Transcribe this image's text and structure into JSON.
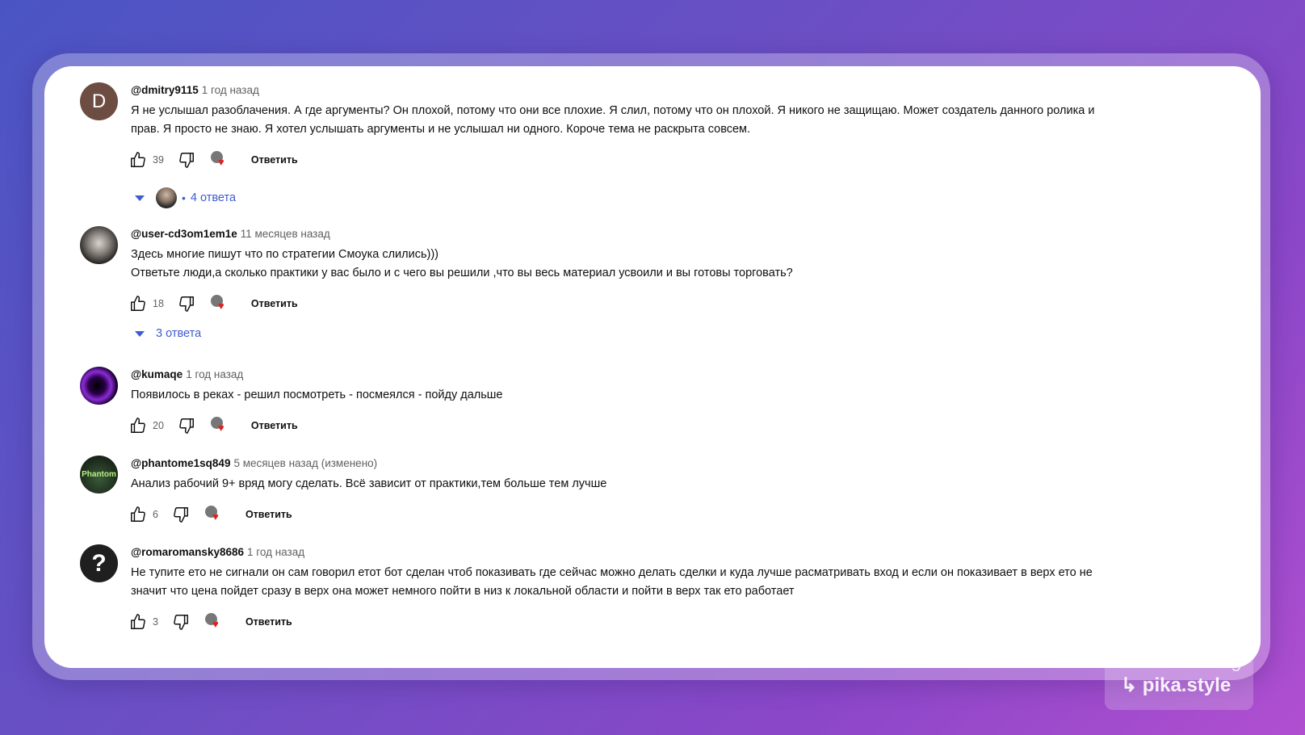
{
  "comments": [
    {
      "author": "@dmitry9115",
      "time": "1 год назад",
      "avatar_letter": "D",
      "text_lines": [
        "Я не услышал разоблачения. А где аргументы? Он плохой, потому что они все плохие. Я слил, потому что он плохой. Я никого не защищаю. Может создатель данного ролика и",
        "прав. Я просто не знаю. Я хотел услышать аргументы и не услышал ни одного. Короче тема не раскрыта совсем."
      ],
      "likes": "39",
      "reply_label": "Ответить",
      "replies": "4 ответа"
    },
    {
      "author": "@user-cd3om1em1e",
      "time": "11 месяцев назад",
      "text_lines": [
        "Здесь многие пишут что по стратегии Смоука слились)))",
        "Ответьте люди,а сколько практики у вас было и с чего вы решили ,что вы весь материал усвоили и вы готовы торговать?"
      ],
      "likes": "18",
      "reply_label": "Ответить",
      "replies": "3 ответа"
    },
    {
      "author": "@kumaqe",
      "time": "1 год назад",
      "text_lines": [
        "Появилось в реках - решил посмотреть - посмеялся - пойду дальше"
      ],
      "likes": "20",
      "reply_label": "Ответить"
    },
    {
      "author": "@phantome1sq849",
      "time": "5 месяцев назад (изменено)",
      "avatar_text": "Phantom",
      "text_lines": [
        "Анализ рабочий 9+ вряд могу сделать. Всё зависит от практики,тем больше тем лучше"
      ],
      "likes": "6",
      "reply_label": "Ответить"
    },
    {
      "author": "@romaromansky8686",
      "time": "1 год назад",
      "avatar_letter": "?",
      "text_lines": [
        "Не тупите ето не сигнали он сам говорил етот бот сделан чтоб показивать где сейчас можно делать сделки и куда лучше расматривать вход и если он показивает в верх ето не",
        "значит что цена пойдет сразу в верх она может немного пойти в низ к локальной области и пойти в верх так ето работает"
      ],
      "likes": "3",
      "reply_label": "Ответить"
    }
  ],
  "watermark": {
    "line1": "Created using",
    "line2": "pika.style"
  },
  "colors": {
    "link": "#3e5bd0",
    "heart": "#e02020"
  }
}
